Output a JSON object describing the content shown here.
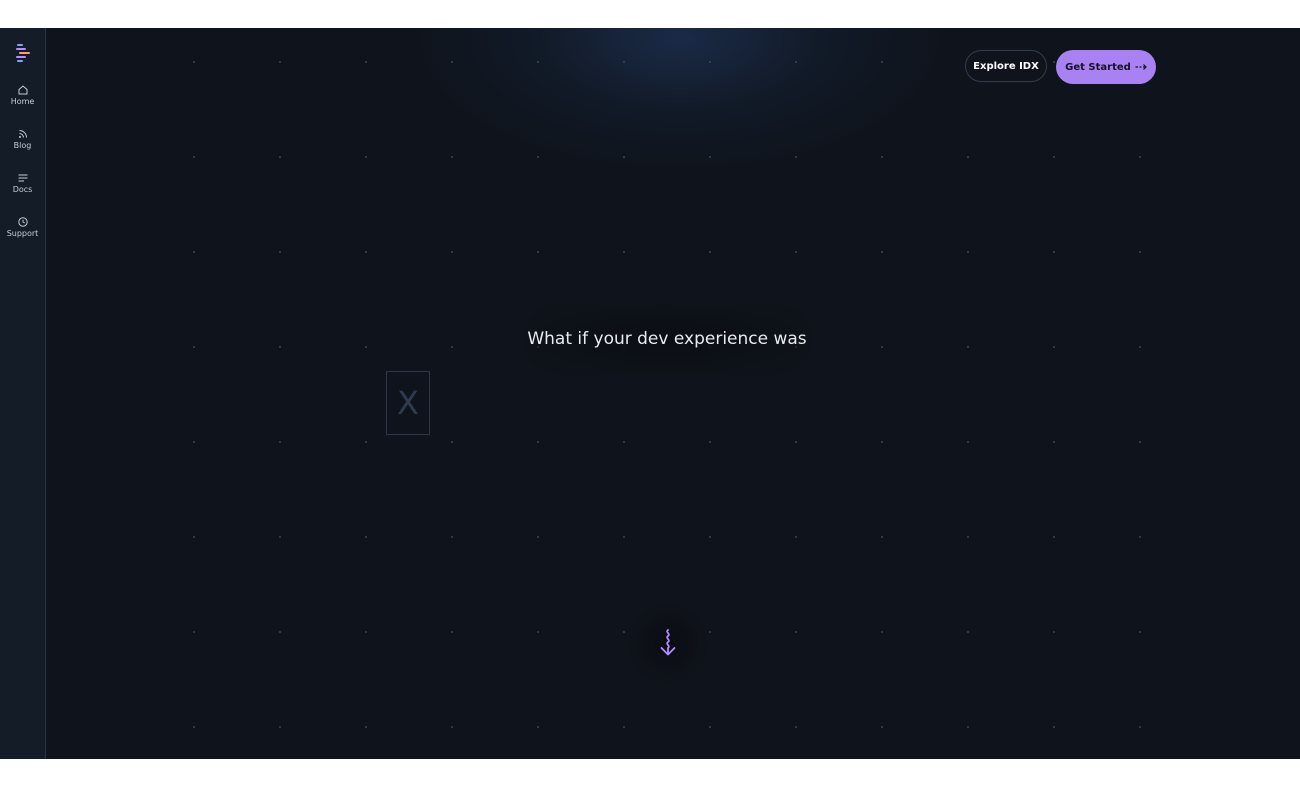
{
  "sidebar": {
    "logo_icon": "idx-logo-icon",
    "items": [
      {
        "label": "Home",
        "icon": "home-icon"
      },
      {
        "label": "Blog",
        "icon": "rss-icon"
      },
      {
        "label": "Docs",
        "icon": "docs-lines-icon"
      },
      {
        "label": "Support",
        "icon": "support-clock-icon"
      }
    ]
  },
  "header": {
    "explore_label": "Explore IDX",
    "get_started_label": "Get Started"
  },
  "hero": {
    "headline": "What if your dev experience was",
    "rotating_letter": "X"
  },
  "colors": {
    "background": "#0f141c",
    "sidebar": "#141c27",
    "accent": "#a882f2"
  }
}
